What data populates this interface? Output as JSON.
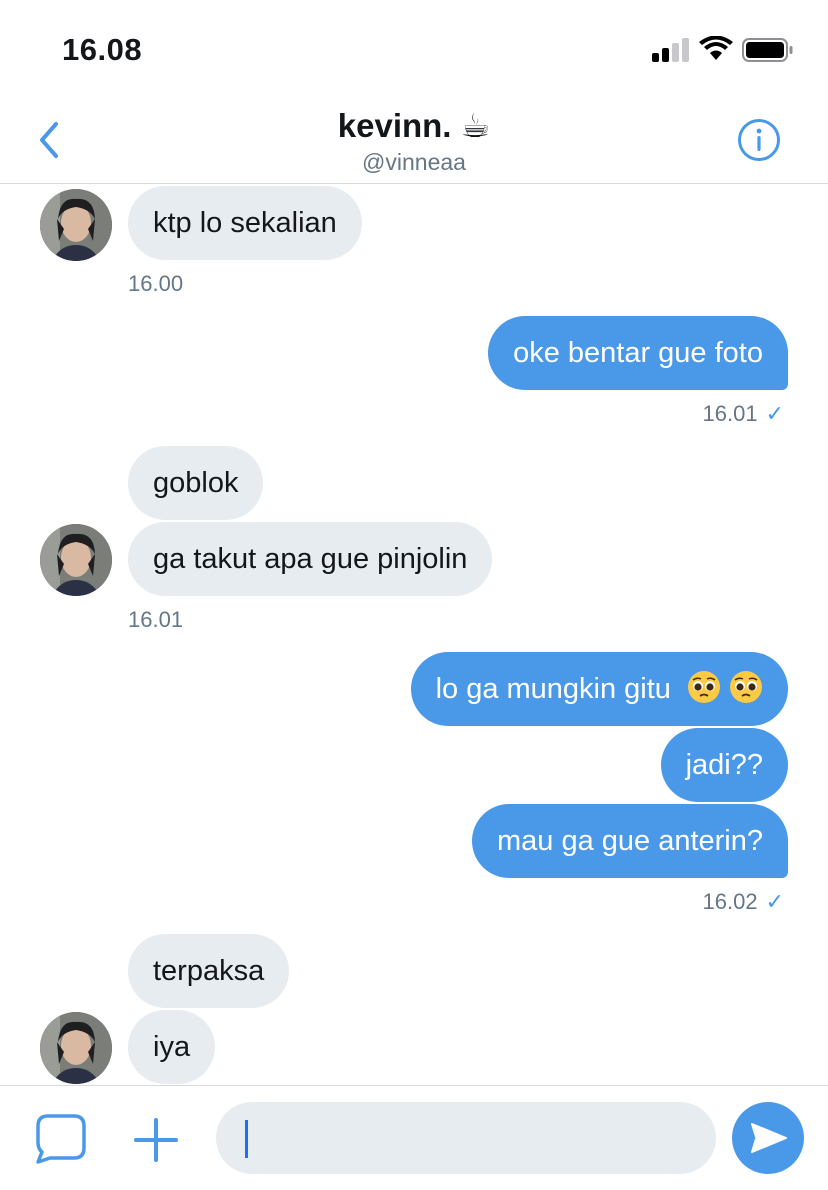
{
  "status_bar": {
    "time": "16.08",
    "signal_icon": "signal-icon",
    "wifi_icon": "wifi-icon",
    "battery_icon": "battery-icon"
  },
  "header": {
    "title": "kevinn. ☕",
    "handle": "@vinneaa",
    "back_icon": "chevron-left-icon",
    "info_icon": "info-icon"
  },
  "messages": [
    {
      "side": "in",
      "text": "ktp lo sekalian"
    },
    {
      "side": "out",
      "text": "oke bentar gue foto"
    },
    {
      "side": "in",
      "text": "goblok"
    },
    {
      "side": "in",
      "text": "ga takut apa gue pinjolin"
    },
    {
      "side": "out",
      "text": "lo ga mungkin gitu",
      "emoji": [
        "pleading-face-emoji",
        "pleading-face-emoji"
      ]
    },
    {
      "side": "out",
      "text": "jadi??"
    },
    {
      "side": "out",
      "text": "mau ga gue anterin?"
    },
    {
      "side": "in",
      "text": "terpaksa"
    },
    {
      "side": "in",
      "text": "iya"
    }
  ],
  "timestamps": [
    {
      "text": "16.00"
    },
    {
      "text": "16.01",
      "check": "✓"
    },
    {
      "text": "16.01"
    },
    {
      "text": "16.02",
      "check": "✓"
    }
  ],
  "composer": {
    "placeholder": "",
    "gif_icon": "speech-bubble-icon",
    "add_icon": "plus-icon",
    "send_icon": "send-icon"
  },
  "colors": {
    "accent": "#4a99e9",
    "incoming_bubble": "#e6ecf0",
    "secondary_text": "#657786"
  }
}
